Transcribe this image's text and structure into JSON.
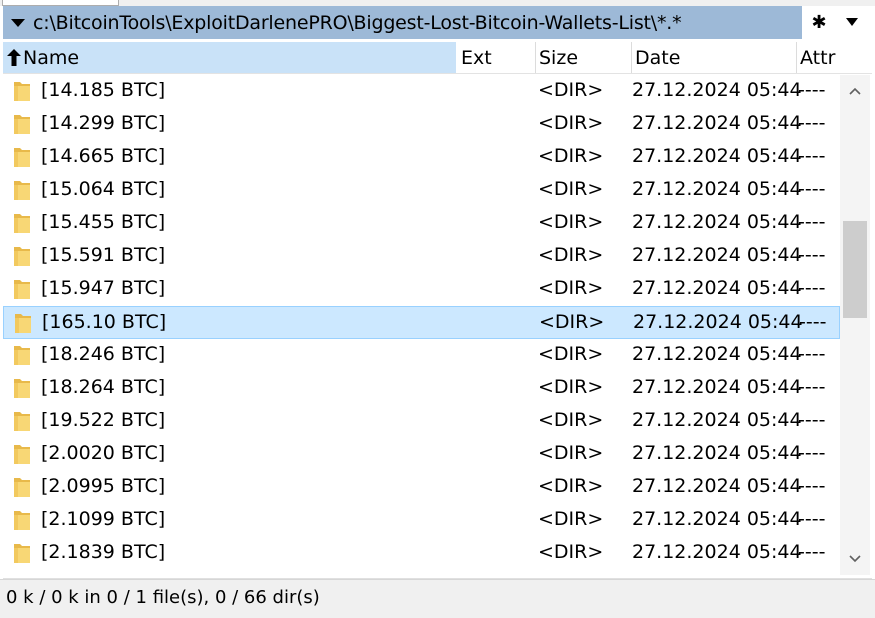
{
  "path_bar": {
    "path": "c:\\BitcoinTools\\ExploitDarlenePRO\\Biggest-Lost-Bitcoin-Wallets-List\\*.*"
  },
  "toolbar": {
    "star_glyph": "✱"
  },
  "columns": {
    "name": "Name",
    "ext": "Ext",
    "size": "Size",
    "date": "Date",
    "attr": "Attr"
  },
  "rows": [
    {
      "name": "[14.185 BTC]",
      "size": "<DIR>",
      "date": "27.12.2024 05:44",
      "attr": "----"
    },
    {
      "name": "[14.299 BTC]",
      "size": "<DIR>",
      "date": "27.12.2024 05:44",
      "attr": "----"
    },
    {
      "name": "[14.665 BTC]",
      "size": "<DIR>",
      "date": "27.12.2024 05:44",
      "attr": "----"
    },
    {
      "name": "[15.064 BTC]",
      "size": "<DIR>",
      "date": "27.12.2024 05:44",
      "attr": "----"
    },
    {
      "name": "[15.455 BTC]",
      "size": "<DIR>",
      "date": "27.12.2024 05:44",
      "attr": "----"
    },
    {
      "name": "[15.591 BTC]",
      "size": "<DIR>",
      "date": "27.12.2024 05:44",
      "attr": "----"
    },
    {
      "name": "[15.947 BTC]",
      "size": "<DIR>",
      "date": "27.12.2024 05:44",
      "attr": "----"
    },
    {
      "name": "[165.10 BTC]",
      "size": "<DIR>",
      "date": "27.12.2024 05:44",
      "attr": "----",
      "selected": true
    },
    {
      "name": "[18.246 BTC]",
      "size": "<DIR>",
      "date": "27.12.2024 05:44",
      "attr": "----"
    },
    {
      "name": "[18.264 BTC]",
      "size": "<DIR>",
      "date": "27.12.2024 05:44",
      "attr": "----"
    },
    {
      "name": "[19.522 BTC]",
      "size": "<DIR>",
      "date": "27.12.2024 05:44",
      "attr": "----"
    },
    {
      "name": "[2.0020 BTC]",
      "size": "<DIR>",
      "date": "27.12.2024 05:44",
      "attr": "----"
    },
    {
      "name": "[2.0995 BTC]",
      "size": "<DIR>",
      "date": "27.12.2024 05:44",
      "attr": "----"
    },
    {
      "name": "[2.1099 BTC]",
      "size": "<DIR>",
      "date": "27.12.2024 05:44",
      "attr": "----"
    },
    {
      "name": "[2.1839 BTC]",
      "size": "<DIR>",
      "date": "27.12.2024 05:44",
      "attr": "----"
    }
  ],
  "status_bar": {
    "text": "0 k / 0 k in 0 / 1 file(s), 0 / 66 dir(s)"
  },
  "colors": {
    "path_bar_bg": "#9db9d7",
    "sort_header_bg": "#c9e2f8",
    "selected_row_bg": "#cce8ff",
    "selected_row_border": "#99d1ff",
    "folder_yellow": "#f8d775"
  }
}
